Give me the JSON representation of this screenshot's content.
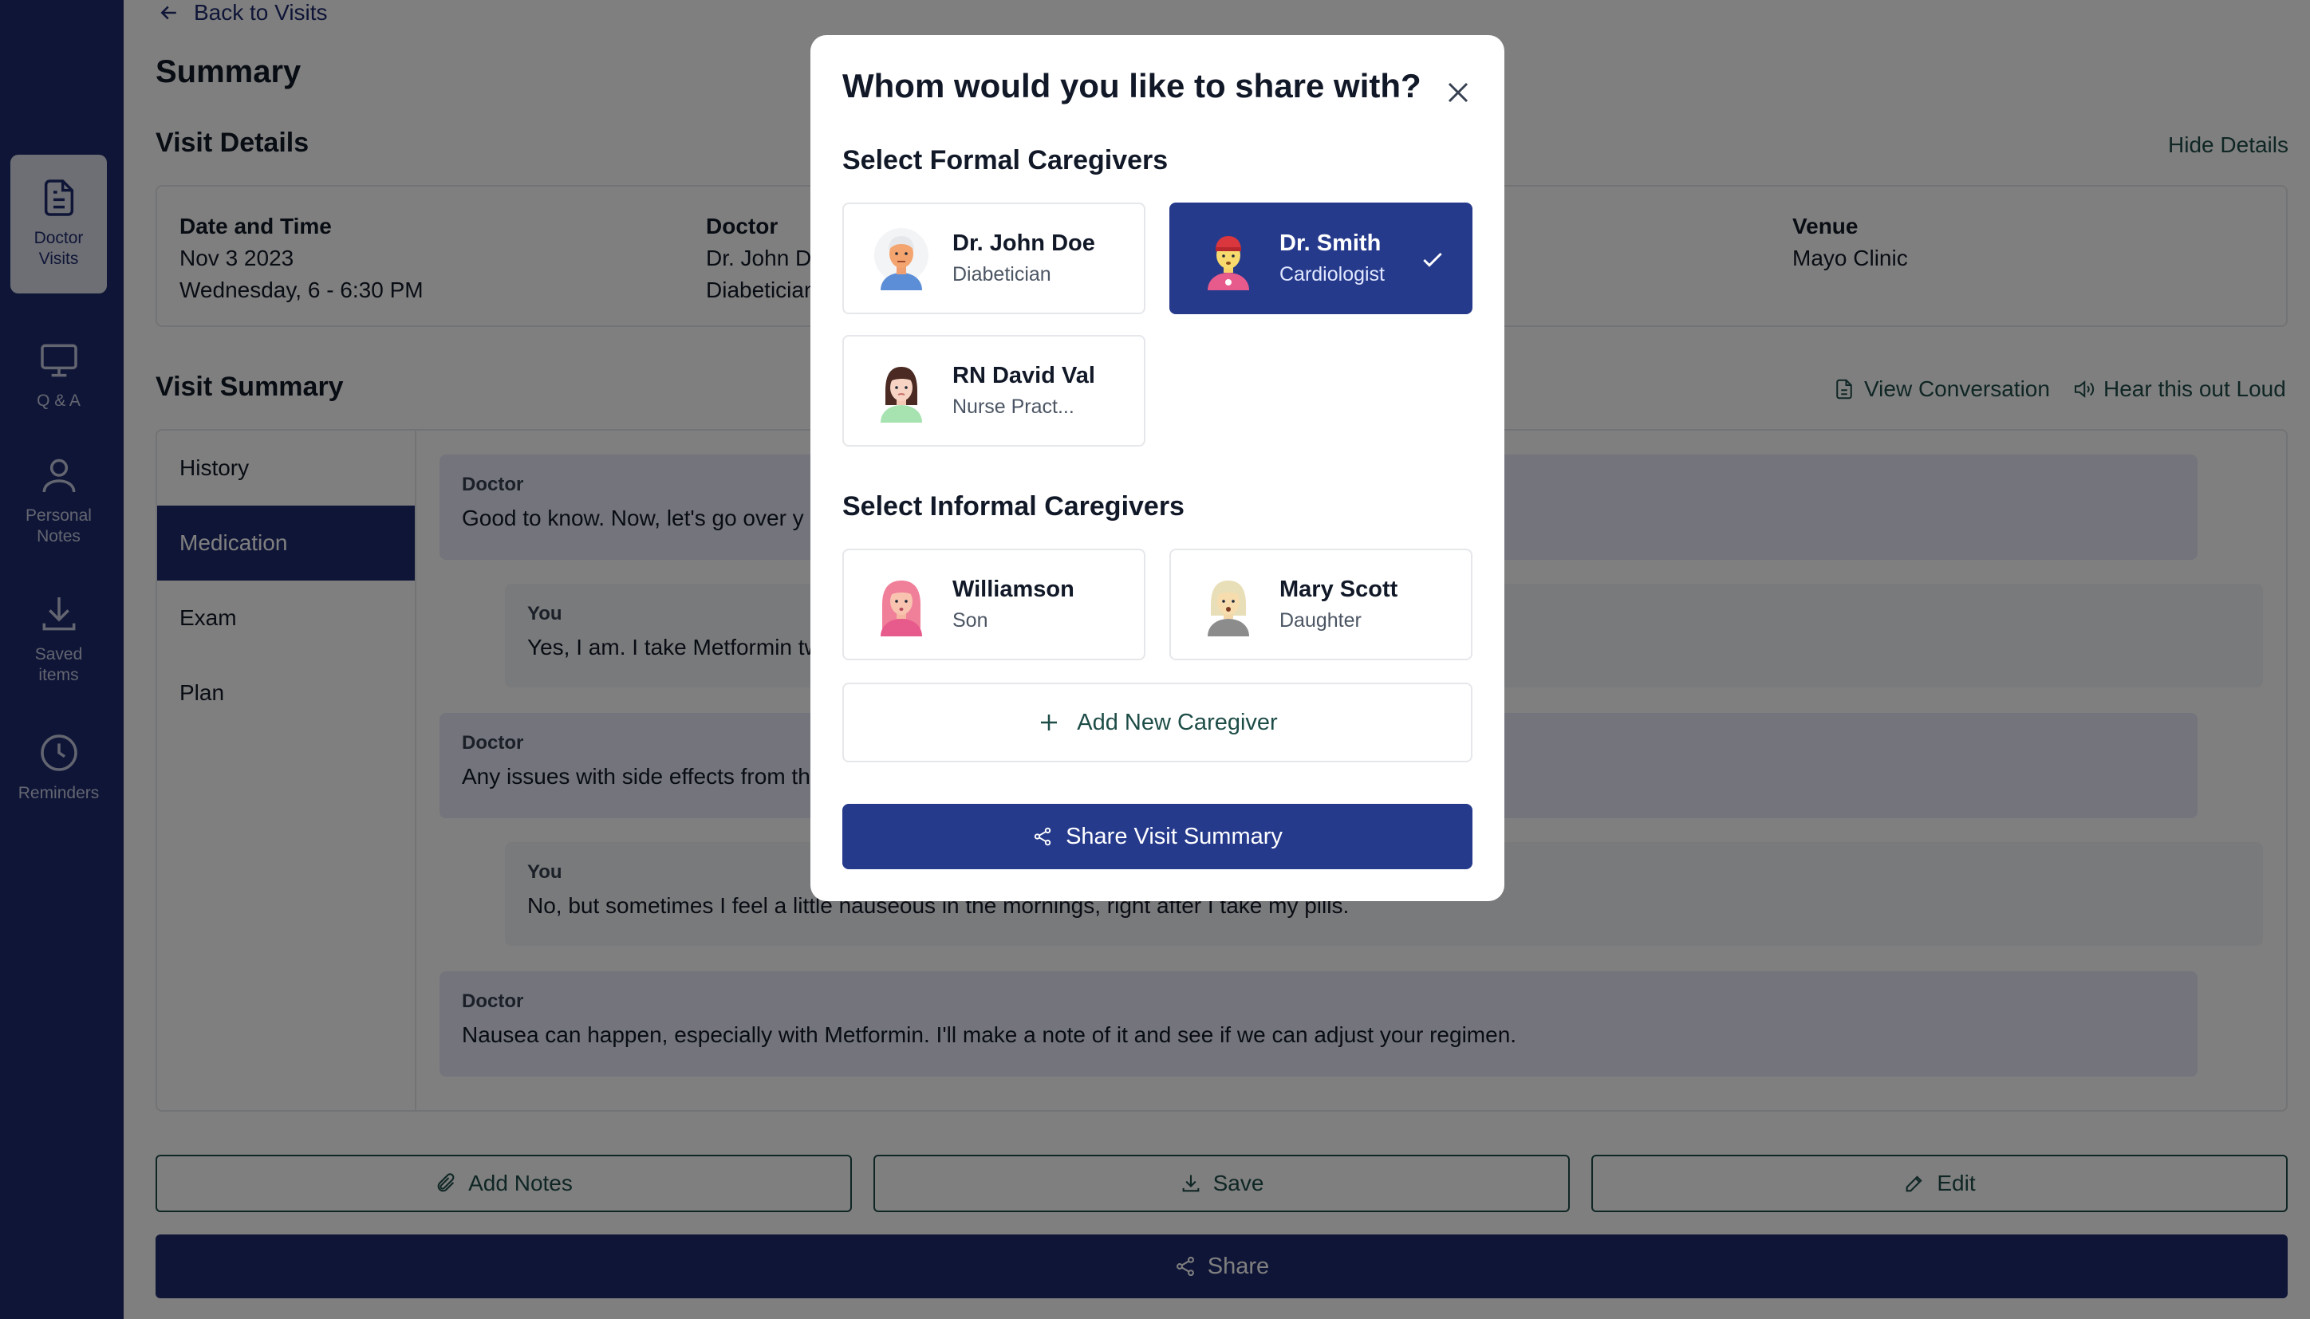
{
  "nav": {
    "items": [
      {
        "label_line1": "Doctor",
        "label_line2": "Visits",
        "icon": "document-icon",
        "active": true
      },
      {
        "label_line1": "Q & A",
        "label_line2": "",
        "icon": "monitor-icon"
      },
      {
        "label_line1": "Personal",
        "label_line2": "Notes",
        "icon": "person-icon"
      },
      {
        "label_line1": "Saved",
        "label_line2": "items",
        "icon": "download-icon"
      },
      {
        "label_line1": "Reminders",
        "label_line2": "",
        "icon": "clock-icon"
      }
    ]
  },
  "header": {
    "back_label": "Back to Visits",
    "title": "Summary"
  },
  "visit_details": {
    "heading": "Visit Details",
    "toggle_label": "Hide Details",
    "date": {
      "label": "Date and Time",
      "line1": "Nov 3 2023",
      "line2": "Wednesday, 6 - 6:30 PM"
    },
    "doctor": {
      "label": "Doctor",
      "line1": "Dr. John D",
      "line2": "Diabetician"
    },
    "venue": {
      "label": "Venue",
      "line1": "Mayo Clinic"
    }
  },
  "visit_summary": {
    "heading": "Visit Summary",
    "view_conversation": "View Conversation",
    "hear_aloud": "Hear this out Loud",
    "tabs": [
      "History",
      "Medication",
      "Exam",
      "Plan"
    ],
    "active_tab": "Medication",
    "messages": [
      {
        "speaker": "Doctor",
        "text": "Good to know. Now, let's go over y"
      },
      {
        "speaker": "You",
        "text": "Yes, I am. I take Metformin tw"
      },
      {
        "speaker": "Doctor",
        "text": "Any issues with side effects from th"
      },
      {
        "speaker": "You",
        "text": "No, but sometimes I feel a little nauseous in the mornings, right after I take my pills."
      },
      {
        "speaker": "Doctor",
        "text": "Nausea can happen, especially with Metformin. I'll make a note of it and see if we can adjust your regimen."
      }
    ]
  },
  "actions": {
    "add_notes": "Add Notes",
    "save": "Save",
    "edit": "Edit",
    "share": "Share"
  },
  "modal": {
    "title": "Whom would you like to share with?",
    "formal_heading": "Select Formal Caregivers",
    "formal": [
      {
        "name": "Dr. John Doe",
        "role": "Diabetician",
        "selected": false
      },
      {
        "name": "Dr. Smith",
        "role": "Cardiologist",
        "selected": true
      },
      {
        "name": "RN David Val",
        "role": "Nurse Pract...",
        "selected": false
      }
    ],
    "informal_heading": "Select Informal Caregivers",
    "informal": [
      {
        "name": "Williamson",
        "role": "Son",
        "selected": false
      },
      {
        "name": "Mary Scott",
        "role": "Daughter",
        "selected": false
      }
    ],
    "add_caregiver": "Add New Caregiver",
    "share_button": "Share Visit Summary"
  },
  "colors": {
    "primary": "#1f2b6e",
    "selected_card": "#263a8c",
    "accent_green": "#1e4d48",
    "doctor_bubble": "#e6e9f8"
  }
}
